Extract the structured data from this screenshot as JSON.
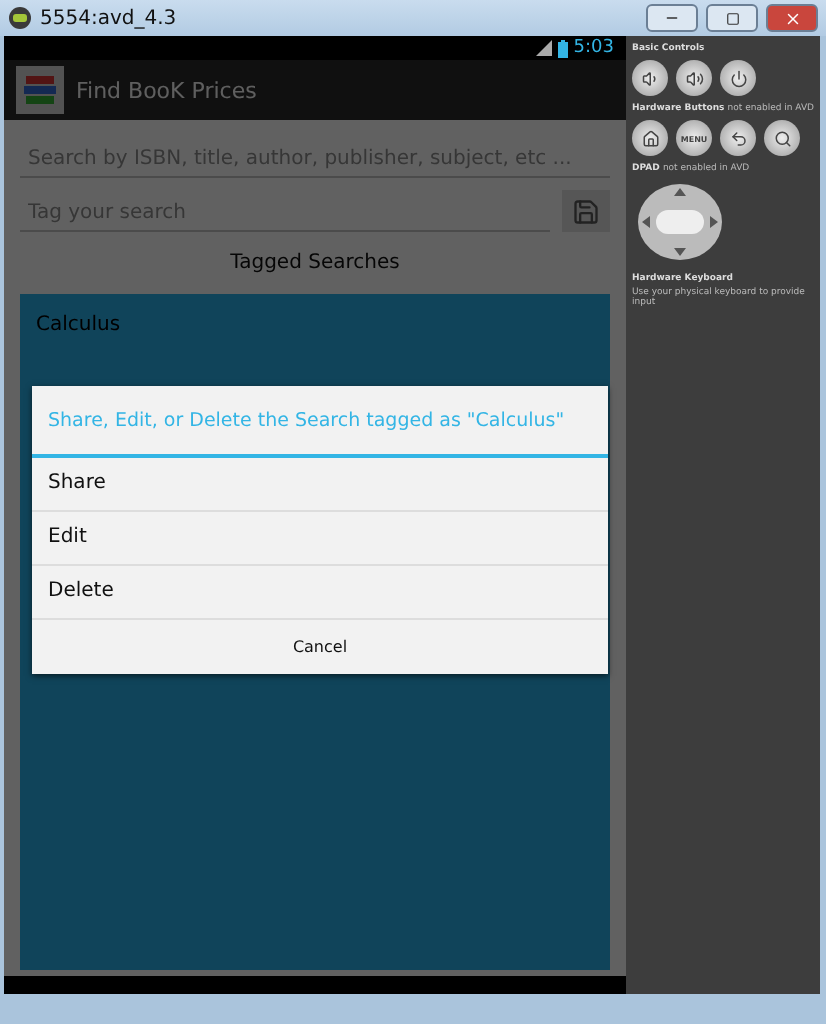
{
  "window": {
    "title": "5554:avd_4.3"
  },
  "status_bar": {
    "time": "5:03"
  },
  "action_bar": {
    "title": "Find BooK Prices"
  },
  "search": {
    "placeholder": "Search by ISBN, title, author, publisher, subject, etc ..."
  },
  "tag": {
    "placeholder": "Tag your search"
  },
  "section_title": "Tagged Searches",
  "tagged_searches": [
    "Calculus"
  ],
  "dialog": {
    "title": "Share, Edit, or Delete the Search tagged as \"Calculus\"",
    "options": [
      "Share",
      "Edit",
      "Delete"
    ],
    "cancel": "Cancel"
  },
  "controls_panel": {
    "basic": {
      "label": "Basic Controls"
    },
    "hardware": {
      "label": "Hardware Buttons",
      "note": "not enabled in AVD",
      "menu": "MENU"
    },
    "dpad": {
      "label": "DPAD",
      "note": "not enabled in AVD"
    },
    "keyboard": {
      "label": "Hardware Keyboard",
      "note": "Use your physical keyboard to provide input"
    }
  }
}
